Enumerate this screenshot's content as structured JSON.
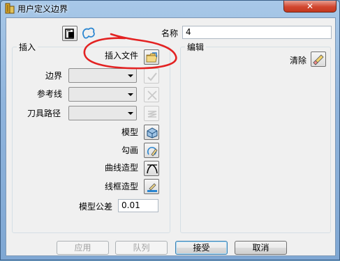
{
  "window": {
    "title": "用户定义边界",
    "close_label": "✕"
  },
  "top": {
    "name_label": "名称",
    "name_value": "4"
  },
  "insert_group": {
    "title": "插入",
    "insert_file_label": "插入文件",
    "boundary_label": "边界",
    "reference_line_label": "参考线",
    "toolpath_label": "刀具路径",
    "model_label": "模型",
    "sketch_label": "勾画",
    "curve_label": "曲线造型",
    "wireframe_label": "线框造型",
    "tolerance_label": "模型公差",
    "tolerance_value": "0.01"
  },
  "edit_group": {
    "title": "编辑",
    "clear_label": "清除"
  },
  "buttons": {
    "apply": "应用",
    "queue": "队列",
    "accept": "接受",
    "cancel": "取消"
  },
  "colors": {
    "title_bar": "#8fb4dc",
    "close_button": "#d2462f",
    "dialog_bg": "#f0f0f0",
    "annotation_red": "#e32222"
  }
}
